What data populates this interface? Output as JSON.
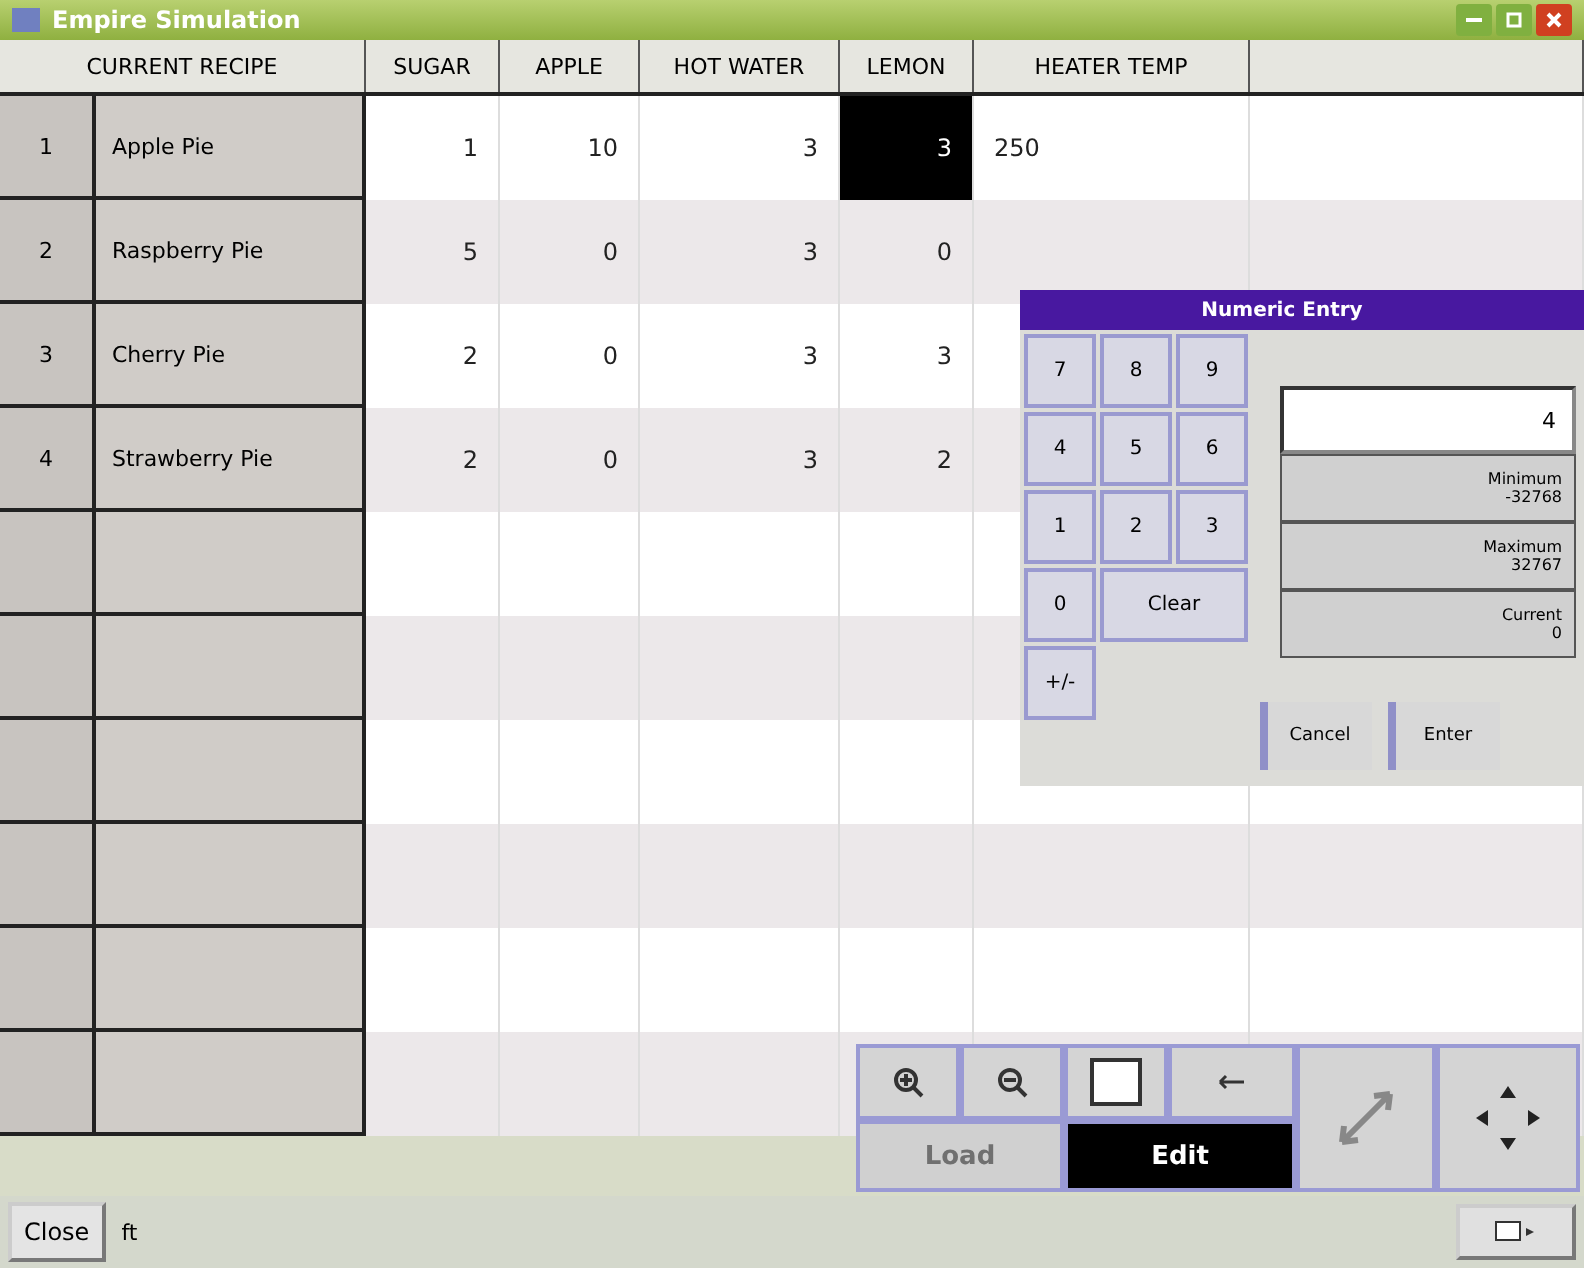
{
  "window": {
    "title": "Empire Simulation"
  },
  "table": {
    "columns": [
      "CURRENT RECIPE",
      "SUGAR",
      "APPLE",
      "HOT WATER",
      "LEMON",
      "HEATER TEMP"
    ],
    "rows": [
      {
        "index": "1",
        "name": "Apple Pie",
        "cells": [
          {
            "text": "1",
            "selected": false
          },
          {
            "text": "10",
            "selected": false
          },
          {
            "text": "3",
            "selected": false
          },
          {
            "text": "3",
            "selected": true
          },
          {
            "text": "250",
            "selected": false
          }
        ]
      },
      {
        "index": "2",
        "name": "Raspberry Pie",
        "cells": [
          {
            "text": "5",
            "selected": false
          },
          {
            "text": "0",
            "selected": false
          },
          {
            "text": "3",
            "selected": false
          },
          {
            "text": "0",
            "selected": false
          }
        ]
      },
      {
        "index": "3",
        "name": "Cherry Pie",
        "cells": [
          {
            "text": "2",
            "selected": false
          },
          {
            "text": "0",
            "selected": false
          },
          {
            "text": "3",
            "selected": false
          },
          {
            "text": "3",
            "selected": false
          }
        ]
      },
      {
        "index": "4",
        "name": "Strawberry Pie",
        "cells": [
          {
            "text": "2",
            "selected": false
          },
          {
            "text": "0",
            "selected": false
          },
          {
            "text": "3",
            "selected": false
          },
          {
            "text": "2",
            "selected": false
          }
        ]
      }
    ]
  },
  "dialog": {
    "title": "Numeric Entry",
    "keys": [
      "7",
      "8",
      "9",
      "4",
      "5",
      "6",
      "1",
      "2",
      "3",
      "0",
      "Clear",
      "+/-"
    ],
    "value": "4",
    "limits": [
      {
        "label": "Minimum",
        "value": "-32768"
      },
      {
        "label": "Maximum",
        "value": "32767"
      },
      {
        "label": "Current",
        "value": "0"
      }
    ],
    "buttons": [
      "Cancel",
      "Enter"
    ]
  },
  "modes": [
    {
      "label": "Load",
      "selected": false
    },
    {
      "label": "Edit",
      "selected": true
    }
  ],
  "status_bar": {
    "button": "Close",
    "text": "ft"
  }
}
